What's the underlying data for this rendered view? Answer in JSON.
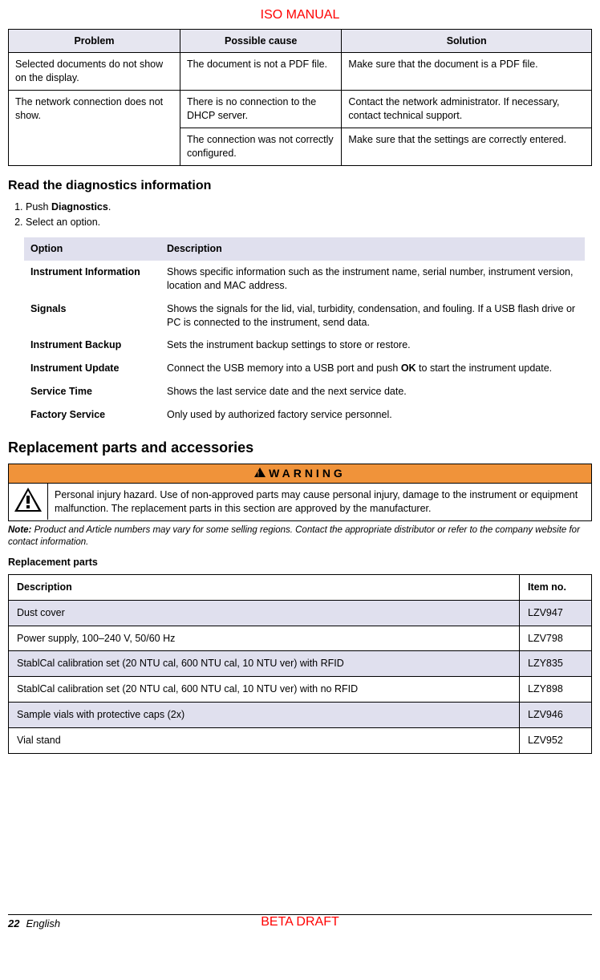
{
  "header": {
    "title": "ISO MANUAL"
  },
  "troubleshoot": {
    "headers": [
      "Problem",
      "Possible cause",
      "Solution"
    ],
    "rows": [
      {
        "problem": "Selected documents do not show on the display.",
        "cause": "The document is not a PDF file.",
        "solution": "Make sure that the document is a PDF file."
      },
      {
        "problem": "The network connection does not show.",
        "cause": "There is no connection to the DHCP server.",
        "solution": "Contact the network administrator. If necessary, contact technical support."
      },
      {
        "problem": "",
        "cause": "The connection was not correctly configured.",
        "solution": "Make sure that the settings are correctly entered."
      }
    ]
  },
  "diag": {
    "heading": "Read the diagnostics information",
    "steps": {
      "s1_pre": "Push ",
      "s1_bold": "Diagnostics",
      "s1_post": ".",
      "s2": "Select an option."
    },
    "headers": [
      "Option",
      "Description"
    ],
    "rows": [
      {
        "opt": "Instrument Information",
        "desc": "Shows specific information such as the instrument name, serial number, instrument version, location and MAC address."
      },
      {
        "opt": "Signals",
        "desc": "Shows the signals for the lid, vial, turbidity, condensation, and fouling. If a USB flash drive or PC is connected to the instrument, send data."
      },
      {
        "opt": "Instrument Backup",
        "desc": "Sets the instrument backup settings to store or restore."
      },
      {
        "opt": "Instrument Update",
        "desc_pre": "Connect the USB memory into a USB port and push ",
        "desc_bold": "OK",
        "desc_post": " to start the instrument update."
      },
      {
        "opt": "Service Time",
        "desc": "Shows the last service date and the next service date."
      },
      {
        "opt": "Factory Service",
        "desc": "Only used by authorized factory service personnel."
      }
    ]
  },
  "replacement": {
    "heading": "Replacement parts and accessories",
    "warning_label": "WARNING",
    "warning_text": "Personal injury hazard. Use of non-approved parts may cause personal injury, damage to the instrument or equipment malfunction. The replacement parts in this section are approved by the manufacturer.",
    "note_label": "Note:",
    "note_body": " Product and Article numbers may vary for some selling regions. Contact the appropriate distributor or refer to the company website for contact information.",
    "subheading": "Replacement parts",
    "headers": [
      "Description",
      "Item no."
    ],
    "rows": [
      {
        "desc": "Dust cover",
        "item": "LZV947"
      },
      {
        "desc": "Power supply, 100–240 V, 50/60 Hz",
        "item": "LZV798"
      },
      {
        "desc": "StablCal calibration set (20 NTU cal, 600 NTU cal, 10 NTU ver) with RFID",
        "item": "LZY835"
      },
      {
        "desc": "StablCal calibration set (20 NTU cal, 600 NTU cal, 10 NTU ver) with no RFID",
        "item": "LZY898"
      },
      {
        "desc": "Sample vials with protective caps (2x)",
        "item": "LZV946"
      },
      {
        "desc": "Vial stand",
        "item": "LZV952"
      }
    ]
  },
  "footer": {
    "page": "22",
    "lang": "English",
    "draft": "BETA DRAFT"
  }
}
